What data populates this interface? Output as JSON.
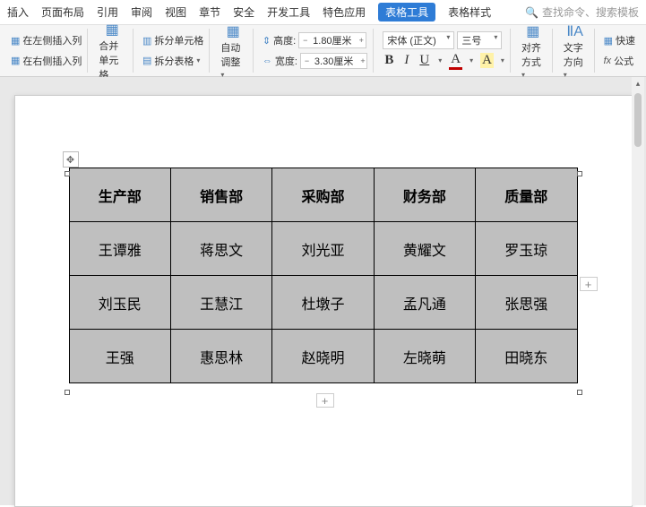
{
  "menu": {
    "items": [
      "插入",
      "页面布局",
      "引用",
      "审阅",
      "视图",
      "章节",
      "安全",
      "开发工具",
      "特色应用"
    ],
    "highlighted": "表格工具",
    "afterHighlight": "表格样式",
    "searchPlaceholder": "查找命令、搜索模板"
  },
  "ribbon": {
    "insertLeft": "在左侧插入列",
    "insertRight": "在右侧插入列",
    "mergeCells": "合并单元格",
    "splitCells": "拆分单元格",
    "splitTable": "拆分表格",
    "autoFit": "自动调整",
    "heightLabel": "高度:",
    "widthLabel": "宽度:",
    "heightValue": "1.80厘米",
    "widthValue": "3.30厘米",
    "fontName": "宋体 (正文)",
    "fontSize": "三号",
    "align": "对齐方式",
    "textDir": "文字方向",
    "quick": "快速",
    "formula": "公式"
  },
  "table": {
    "headers": [
      "生产部",
      "销售部",
      "采购部",
      "财务部",
      "质量部"
    ],
    "rows": [
      [
        "王谭雅",
        "蒋思文",
        "刘光亚",
        "黄耀文",
        "罗玉琼"
      ],
      [
        "刘玉民",
        "王慧江",
        "杜墩子",
        "孟凡通",
        "张思强"
      ],
      [
        "王强",
        "惠思林",
        "赵晓明",
        "左晓萌",
        "田晓东"
      ]
    ]
  }
}
